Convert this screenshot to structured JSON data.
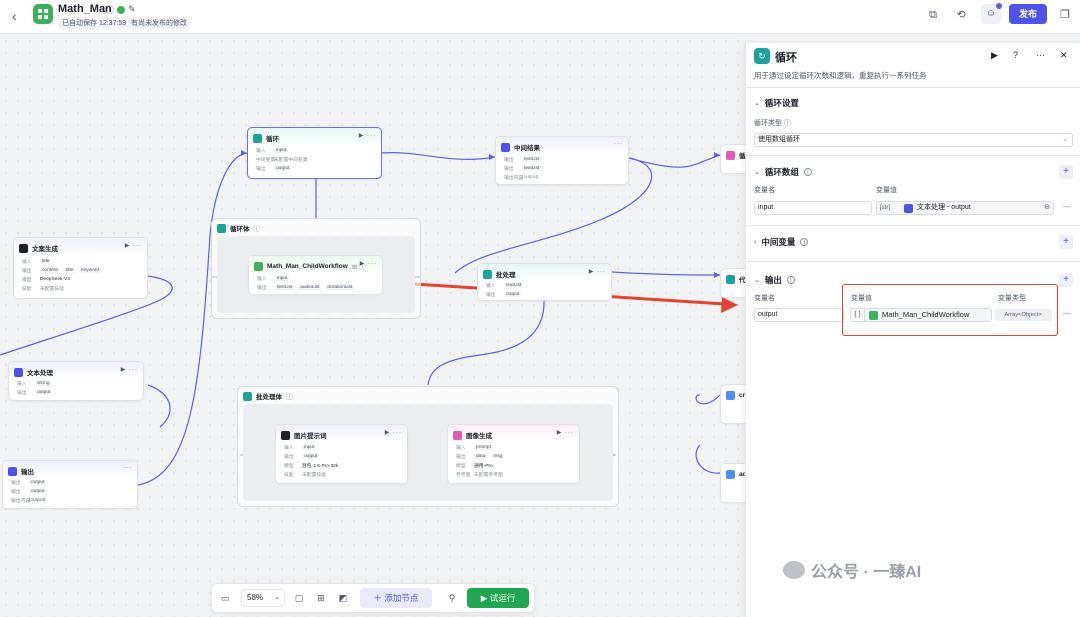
{
  "app": {
    "title": "Math_Man",
    "saved_status": "已自动保存 12:37:59",
    "unpublished": "有尚未发布的修改",
    "publish_label": "发布"
  },
  "canvas": {
    "nodes": {
      "text_gen": {
        "title": "文案生成",
        "r1k": "输入",
        "r1v": [
          "title"
        ],
        "r2k": "输出",
        "r2v": [
          "content",
          "title",
          "keyword"
        ],
        "r3k": "模型",
        "r3v": "DeepSeek-V3",
        "r4k": "技能",
        "r4v": "未配置技能"
      },
      "text_proc": {
        "title": "文本处理",
        "r1k": "输入",
        "r1v": "String",
        "r2k": "输出",
        "r2v": "output"
      },
      "output_node": {
        "title": "输出",
        "r1k": "输出",
        "r1v": "output",
        "r2k": "输出",
        "r2v": "output",
        "r3k": "输出内容",
        "r3v": "{output}"
      },
      "loop": {
        "title": "循环",
        "r1k": "输入",
        "r1v": "input",
        "r2k": "中间变量",
        "r2v": "未配置中间变量",
        "r3k": "输出",
        "r3v": "output"
      },
      "loop_body": {
        "title": "循环体"
      },
      "child": {
        "title": "Math_Man_ChildWorkflow",
        "r1k": "输入",
        "r1v": "input",
        "r2k": "输出",
        "r2v": [
          "textList",
          "audioList",
          "durationList"
        ]
      },
      "mid_result": {
        "title": "中间结果",
        "r1k": "输出",
        "r1v": "textList",
        "r2k": "输出",
        "r2v": "textList",
        "r3k": "输出内容",
        "r3v": "{output}"
      },
      "batch": {
        "title": "批处理",
        "r1k": "输入",
        "r1v": "textList",
        "r2k": "输出",
        "r2v": "output"
      },
      "batch_body": {
        "title": "批处理体"
      },
      "img_prompt": {
        "title": "图片提示词",
        "r1k": "输入",
        "r1v": "input",
        "r2k": "输出",
        "r2v": "output",
        "r3k": "模型",
        "r3v": "豆包·1.6·Pro·32k",
        "r4k": "技能",
        "r4v": "未配置技能"
      },
      "img_gen": {
        "title": "图像生成",
        "r1k": "输入",
        "r1v": "prompt",
        "r2k": "输出",
        "r2v": [
          "data",
          "msg"
        ],
        "r3k": "模型",
        "r3v": "通用-Pro",
        "r4k": "参考图",
        "r4v": "未配置参考图"
      },
      "right_partial": [
        "循",
        "代",
        "cre",
        "ad"
      ]
    }
  },
  "toolbar": {
    "zoom": "58%",
    "add_node": "添加节点",
    "run": "试运行"
  },
  "panel": {
    "title": "循环",
    "description": "用于通过设定循环次数和逻辑，重复执行一系列任务",
    "loop_settings": {
      "title": "循环设置",
      "type_label": "循环类型",
      "type_value": "使用数组循环"
    },
    "loop_array": {
      "title": "循环数组",
      "name_header": "变量名",
      "value_header": "变量值",
      "var_name": "input",
      "var_value": "文本处理 - output",
      "var_prefix": "[str]"
    },
    "mid_vars": {
      "title": "中间变量"
    },
    "output": {
      "title": "输出",
      "name_header": "变量名",
      "value_header": "变量值",
      "type_header": "变量类型",
      "var_name": "output",
      "var_value": "Math_Man_ChildWorkflow",
      "var_type": "Array<Object>"
    }
  },
  "watermark": "公众号 · 一臻AI",
  "colors": {
    "primary": "#4d53e8",
    "run_green": "#1fa650",
    "loop_teal": "#1ba39c",
    "workflow_green": "#3cb05a",
    "annotation_red": "#e2442f"
  }
}
